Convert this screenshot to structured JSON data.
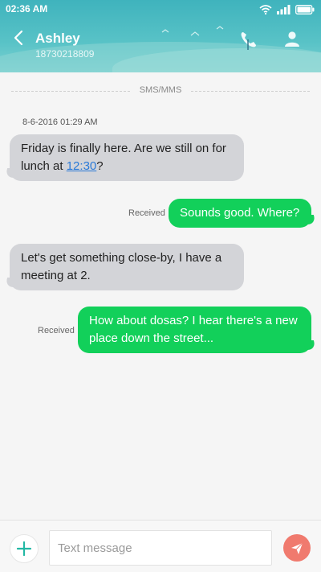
{
  "status_bar": {
    "time": "02:36 AM",
    "icons": [
      "wifi-icon",
      "signal-icon",
      "battery-icon"
    ]
  },
  "header": {
    "contact_name": "Ashley",
    "contact_number": "18730218809",
    "back_icon": "chevron-left-icon",
    "call_icon": "phone-icon",
    "contact_icon": "person-icon"
  },
  "thread": {
    "channel_label": "SMS/MMS",
    "timestamp": "8-6-2016 01:29 AM",
    "messages": [
      {
        "direction": "incoming",
        "text_before": "Friday is finally here. Are we still on for lunch at ",
        "link": "12:30",
        "text_after": "?"
      },
      {
        "direction": "outgoing",
        "status": "Received",
        "text": "Sounds good. Where?"
      },
      {
        "direction": "incoming",
        "text": "Let's get something close-by, I have a meeting at 2."
      },
      {
        "direction": "outgoing",
        "status": "Received",
        "text": "How about dosas? I hear there's a new place down the street..."
      }
    ]
  },
  "composer": {
    "add_icon": "plus-icon",
    "placeholder": "Text message",
    "value": "",
    "send_icon": "send-icon"
  },
  "colors": {
    "header_teal": "#3fb3bd",
    "incoming_bubble": "#d3d4d8",
    "outgoing_bubble": "#12d05a",
    "link": "#2a7ad8",
    "send_button": "#f07a6e",
    "add_plus": "#23b8a4"
  }
}
